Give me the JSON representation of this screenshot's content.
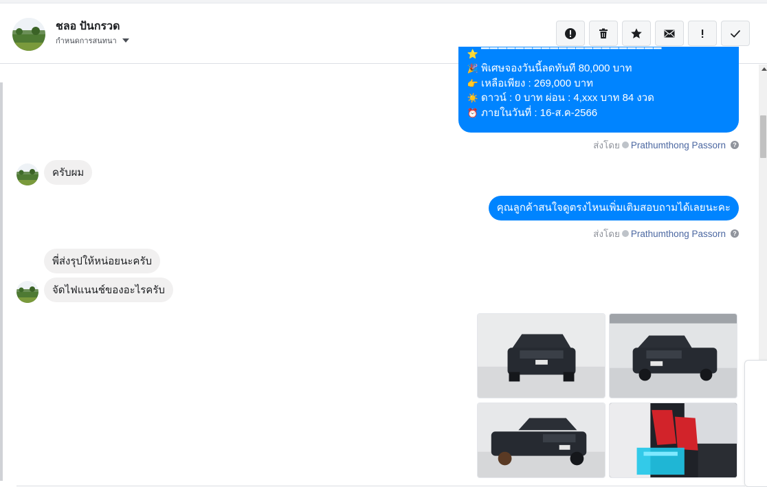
{
  "header": {
    "contact_name": "ชลอ ปันกรวด",
    "subtitle": "กำหนดการสนทนา",
    "actions": [
      {
        "icon": "alert-circle-icon",
        "name": "report-button"
      },
      {
        "icon": "trash-icon",
        "name": "delete-button"
      },
      {
        "icon": "star-icon",
        "name": "star-button"
      },
      {
        "icon": "envelope-icon",
        "name": "mark-unread-button"
      },
      {
        "icon": "exclamation-icon",
        "name": "spam-button"
      },
      {
        "icon": "checkmark-icon",
        "name": "mark-done-button"
      }
    ]
  },
  "messages": {
    "offer": {
      "lines": [
        {
          "emoji": "🎉",
          "text": "พิเศษจองวันนี้ลดทันที 80,000 บาท"
        },
        {
          "emoji": "👉",
          "text": "เหลือเพียง : 269,000 บาท"
        },
        {
          "emoji": "☀️",
          "text": "ดาวน์ : 0 บาท ผ่อน : 4,xxx บาท 84 งวด"
        },
        {
          "emoji": "⏰",
          "text": "ภายในวันที่ : 16-ส.ค-2566"
        }
      ]
    },
    "sent_by_prefix": "ส่งโดย",
    "agent_name": "Prathumthong Passorn",
    "reply_1": "ครับผม",
    "question": "คุณลูกค้าสนใจดูตรงไหนเพิ่มเติมสอบถามได้เลยนะคะ",
    "reply_2": "พี่ส่งรุปให้หน่อยนะครับ",
    "reply_3": "จัดไฟแนนช์ของอะไรครับ"
  },
  "colors": {
    "outgoing_bubble": "#0084ff",
    "incoming_bubble": "#f1f0f0",
    "agent_link": "#4b67a1"
  }
}
